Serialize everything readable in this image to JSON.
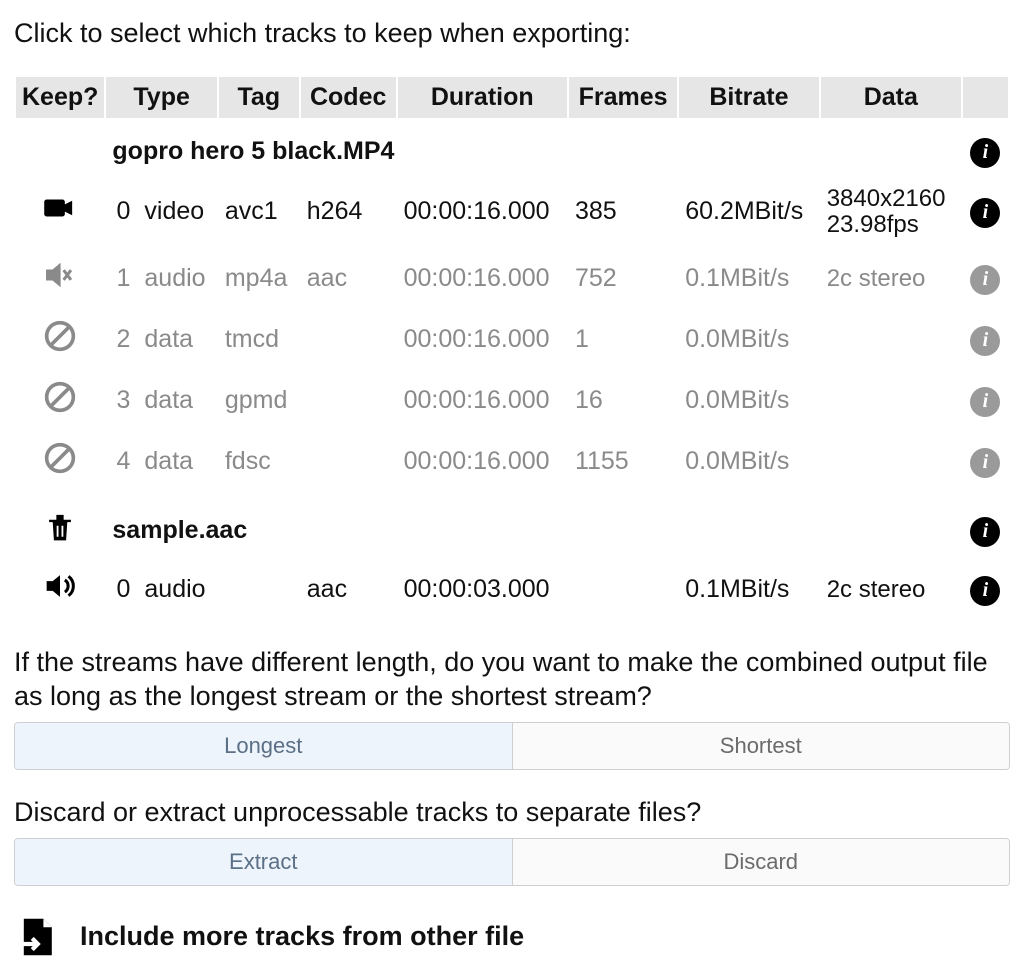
{
  "heading": "Click to select which tracks to keep when exporting:",
  "columns": {
    "keep": "Keep?",
    "type": "Type",
    "tag": "Tag",
    "codec": "Codec",
    "duration": "Duration",
    "frames": "Frames",
    "bitrate": "Bitrate",
    "data": "Data"
  },
  "files": [
    {
      "name": "gopro hero 5 black.MP4",
      "icon": "none",
      "tracks": [
        {
          "icon": "video",
          "dim": false,
          "index": "0",
          "type": "video",
          "tag": "avc1",
          "codec": "h264",
          "duration": "00:00:16.000",
          "frames": "385",
          "bitrate": "60.2MBit/s",
          "data_line1": "3840x2160",
          "data_line2": "23.98fps"
        },
        {
          "icon": "audio-mute",
          "dim": true,
          "index": "1",
          "type": "audio",
          "tag": "mp4a",
          "codec": "aac",
          "duration": "00:00:16.000",
          "frames": "752",
          "bitrate": "0.1MBit/s",
          "data_line1": "2c stereo",
          "data_line2": ""
        },
        {
          "icon": "ban",
          "dim": true,
          "index": "2",
          "type": "data",
          "tag": "tmcd",
          "codec": "",
          "duration": "00:00:16.000",
          "frames": "1",
          "bitrate": "0.0MBit/s",
          "data_line1": "",
          "data_line2": ""
        },
        {
          "icon": "ban",
          "dim": true,
          "index": "3",
          "type": "data",
          "tag": "gpmd",
          "codec": "",
          "duration": "00:00:16.000",
          "frames": "16",
          "bitrate": "0.0MBit/s",
          "data_line1": "",
          "data_line2": ""
        },
        {
          "icon": "ban",
          "dim": true,
          "index": "4",
          "type": "data",
          "tag": "fdsc",
          "codec": "",
          "duration": "00:00:16.000",
          "frames": "1155",
          "bitrate": "0.0MBit/s",
          "data_line1": "",
          "data_line2": ""
        }
      ]
    },
    {
      "name": "sample.aac",
      "icon": "trash",
      "tracks": [
        {
          "icon": "audio-on",
          "dim": false,
          "index": "0",
          "type": "audio",
          "tag": "",
          "codec": "aac",
          "duration": "00:00:03.000",
          "frames": "",
          "bitrate": "0.1MBit/s",
          "data_line1": "2c stereo",
          "data_line2": ""
        }
      ]
    }
  ],
  "length_question": "If the streams have different length, do you want to make the combined output file as long as the longest stream or the shortest stream?",
  "length_options": {
    "longest": "Longest",
    "shortest": "Shortest",
    "selected": "longest"
  },
  "discard_question": "Discard or extract unprocessable tracks to separate files?",
  "discard_options": {
    "extract": "Extract",
    "discard": "Discard",
    "selected": "extract"
  },
  "include_more": "Include more tracks from other file"
}
